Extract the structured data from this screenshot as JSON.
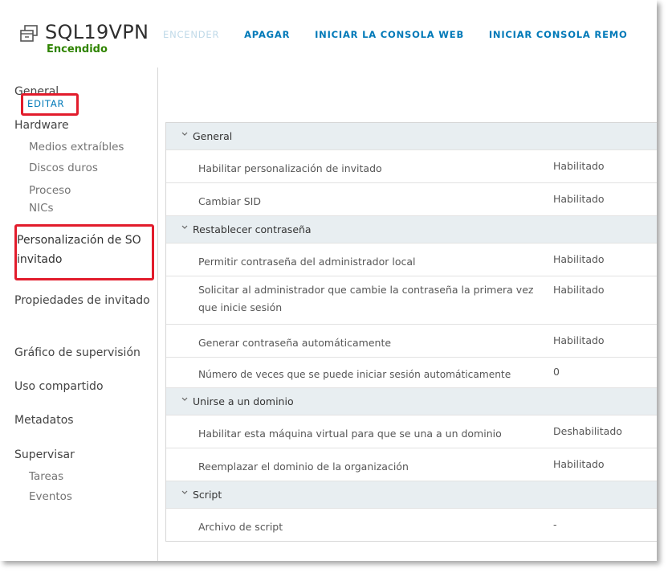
{
  "header": {
    "vm_name": "SQL19VPN",
    "vm_status": "Encendido",
    "actions": [
      "ENCENDER",
      "APAGAR",
      "INICIAR LA CONSOLA WEB",
      "INICIAR CONSOLA REMO"
    ]
  },
  "sidebar": {
    "general": "General",
    "hardware": "Hardware",
    "hardware_items": [
      "Medios extraíbles",
      "Discos duros",
      "Proceso",
      "NICs"
    ],
    "guest_os": "Personalización de SO invitado",
    "guest_props": "Propiedades de invitado",
    "monitor_graph": "Gráfico de supervisión",
    "sharing": "Uso compartido",
    "metadata": "Metadatos",
    "monitor": "Supervisar",
    "monitor_items": [
      "Tareas",
      "Eventos"
    ]
  },
  "main": {
    "edit_label": "EDITAR",
    "sections": [
      {
        "title": "General",
        "rows": [
          {
            "label": "Habilitar personalización de invitado",
            "value": "Habilitado"
          },
          {
            "label": "Cambiar SID",
            "value": "Habilitado"
          }
        ]
      },
      {
        "title": "Restablecer contraseña",
        "rows": [
          {
            "label": "Permitir contraseña del administrador local",
            "value": "Habilitado"
          },
          {
            "label": "Solicitar al administrador que cambie la contraseña la primera vez que inicie sesión",
            "value": "Habilitado"
          },
          {
            "label": "Generar contraseña automáticamente",
            "value": "Habilitado"
          },
          {
            "label": "Número de veces que se puede iniciar sesión automáticamente",
            "value": "0"
          }
        ]
      },
      {
        "title": "Unirse a un dominio",
        "rows": [
          {
            "label": "Habilitar esta máquina virtual para que se una a un dominio",
            "value": "Deshabilitado"
          },
          {
            "label": "Reemplazar el dominio de la organización",
            "value": "Habilitado"
          }
        ]
      },
      {
        "title": "Script",
        "rows": [
          {
            "label": "Archivo de script",
            "value": "-"
          }
        ]
      }
    ]
  },
  "colors": {
    "accent": "#0079b8",
    "status_on": "#2f8400",
    "highlight": "#e21c2c",
    "group_bg": "#e8eef1"
  }
}
